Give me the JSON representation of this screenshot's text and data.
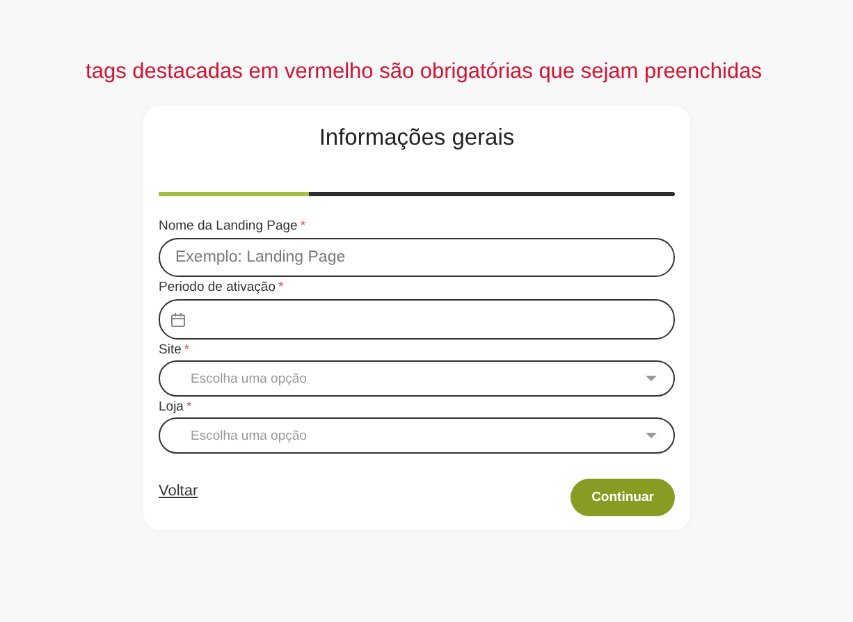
{
  "notice": "tags destacadas em vermelho são obrigatórias que sejam preenchidas",
  "form": {
    "title": "Informações gerais",
    "progress": {
      "level": 0.29
    },
    "fields": [
      {
        "kind": "text",
        "label": "Nome da Landing Page",
        "required": "*",
        "placeholder": "Exemplo: Landing Page"
      },
      {
        "kind": "date",
        "label": "Periodo de ativação",
        "required": "*"
      },
      {
        "kind": "select",
        "label": "Site",
        "required": "*",
        "placeholder": "Escolha uma opção"
      },
      {
        "kind": "select",
        "label": "Loja",
        "required": "*",
        "placeholder": "Escolha uma opção"
      }
    ],
    "back": "Voltar",
    "submit": "Continuar"
  }
}
